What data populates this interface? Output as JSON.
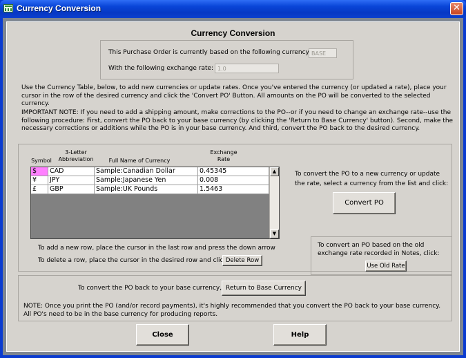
{
  "window": {
    "title": "Currency Conversion",
    "close_glyph": "✕"
  },
  "heading": "Currency Conversion",
  "current_currency": {
    "label": "This Purchase Order is currently based on the following currency:",
    "value": "BASE",
    "rate_label": "With the following exchange rate:",
    "rate_value": "1.0"
  },
  "instructions": "Use the Currency Table, below, to add new currencies or update rates.  Once you've entered the currency (or updated a rate), place your\ncursor in the row of the desired currency and click the 'Convert PO' Button.  All amounts on the PO will be converted to the selected currency.",
  "important_note": "IMPORTANT NOTE:  If you need to add a shipping amount, make corrections to the PO--or if you need to change an exchange rate--use the\nfollowing procedure:  First, convert the PO back to your base currency (by clicking the 'Return to Base Currency' button).  Second, make the\nnecessary corrections or additions while the PO is in your base currency.  And third, convert the PO back to the desired currency.",
  "table": {
    "headers": {
      "symbol": "Symbol",
      "abbr": "3-Letter\nAbbreviation",
      "name": "Full Name of Currency",
      "rate": "Exchange\nRate"
    },
    "rows": [
      {
        "symbol": "$",
        "abbr": "CAD",
        "name": "Sample:Canadian Dollar",
        "rate": "0.45345"
      },
      {
        "symbol": "¥",
        "abbr": "JPY",
        "name": "Sample:Japanese Yen",
        "rate": "0.008"
      },
      {
        "symbol": "£",
        "abbr": "GBP",
        "name": "Sample:UK Pounds",
        "rate": "1.5463"
      }
    ],
    "add_row_hint": "To add a new row, place the cursor in the last row and press the down arrow",
    "delete_row_hint": "To delete a row, place the cursor in the desired row and click",
    "delete_row_button": "Delete Row"
  },
  "convert": {
    "hint": "To convert the PO to a new currency or update\nthe rate, select a currency from the list and click:",
    "button": "Convert PO"
  },
  "old_rate": {
    "hint": "To convert an PO based on the old\nexchange rate recorded in Notes, click:",
    "button": "Use Old Rate"
  },
  "base": {
    "hint": "To convert the PO back to your base currency, click:",
    "button": "Return to Base Currency",
    "note": "NOTE: Once you print the PO (and/or record payments), it's highly recommended that you convert the PO back to your base currency.\nAll PO's need to be in the base currency for producing reports."
  },
  "footer": {
    "close_button": "Close",
    "help_button": "Help"
  },
  "colors": {
    "titlebar": "#0a46d8",
    "panel": "#d6d3ce",
    "grid_empty": "#818181",
    "selected_cell": "#ff80ff"
  }
}
